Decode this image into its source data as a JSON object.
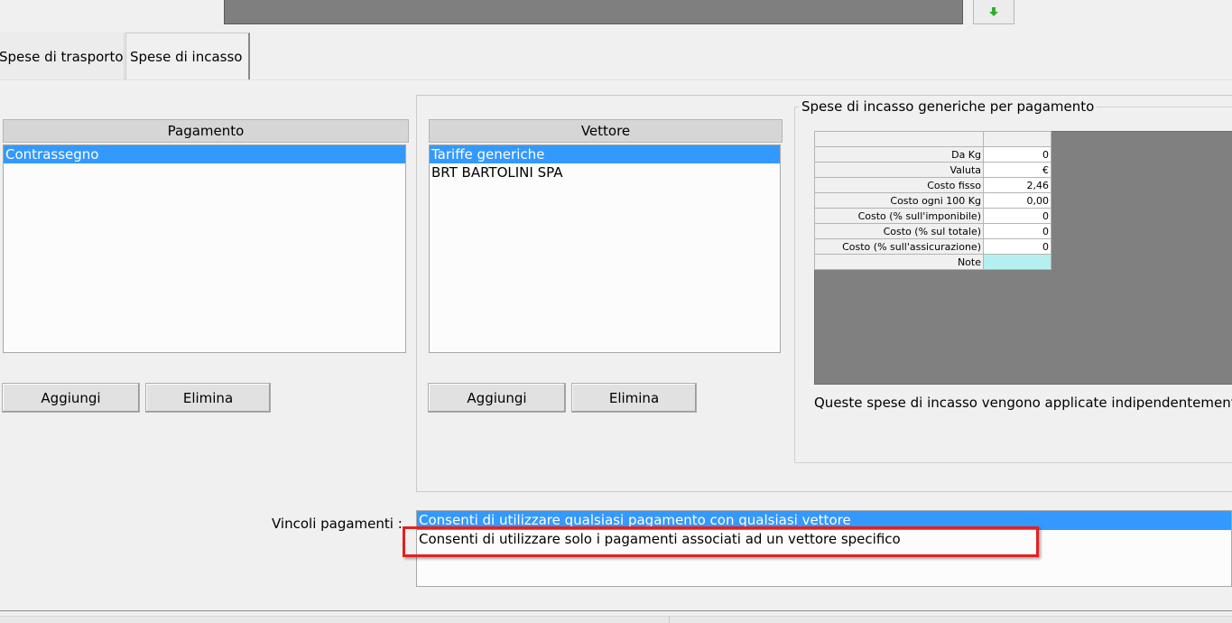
{
  "tabs": [
    {
      "label": "Spese di trasporto"
    },
    {
      "label": "Spese di incasso"
    }
  ],
  "pagamento": {
    "header": "Pagamento",
    "items": [
      "Contrassegno"
    ],
    "add_label": "Aggiungi",
    "delete_label": "Elimina"
  },
  "vettore": {
    "header": "Vettore",
    "items": [
      "Tariffe generiche",
      "BRT BARTOLINI SPA"
    ],
    "add_label": "Aggiungi",
    "delete_label": "Elimina"
  },
  "spese_incasso": {
    "title": "Spese di incasso generiche per pagamento",
    "rows": [
      {
        "label": "Da Kg",
        "value": "0"
      },
      {
        "label": "Valuta",
        "value": "€"
      },
      {
        "label": "Costo fisso",
        "value": "2,46"
      },
      {
        "label": "Costo ogni 100 Kg",
        "value": "0,00"
      },
      {
        "label": "Costo (% sull'imponibile)",
        "value": "0"
      },
      {
        "label": "Costo (% sul totale)",
        "value": "0"
      },
      {
        "label": "Costo (% sull'assicurazione)",
        "value": "0"
      },
      {
        "label": "Note",
        "value": ""
      }
    ],
    "info_text": "Queste spese di incasso vengono applicate indipendentemente"
  },
  "vincoli": {
    "label": "Vincoli pagamenti :",
    "options": [
      "Consenti di utilizzare qualsiasi pagamento con qualsiasi vettore",
      "Consenti di utilizzare solo i pagamenti associati ad un vettore specifico"
    ]
  },
  "colors": {
    "selection": "#3399ff",
    "highlight": "#e32020",
    "note_cell": "#b4f0f0"
  }
}
